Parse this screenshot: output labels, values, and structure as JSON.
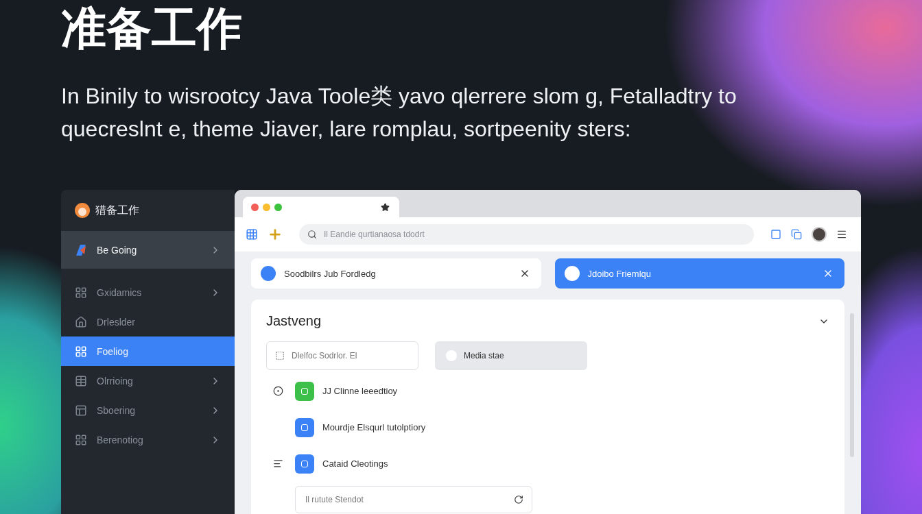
{
  "heading": {
    "title": "准备工作",
    "text": "In Binily to wisrootcy Java Toole类 yavo qlerrere slom g, Fetalladtry to quecreslnt e, theme Jiaver, lare romplau, sortpeenity sters:"
  },
  "sidebar": {
    "title": "猎备工作",
    "items": [
      {
        "label": "Be Going",
        "kind": "logo",
        "selected": false,
        "highlighted": true,
        "chevron": true
      },
      {
        "label": "Gxidamics",
        "kind": "grid",
        "selected": false,
        "highlighted": false,
        "chevron": true
      },
      {
        "label": "Drleslder",
        "kind": "home",
        "selected": false,
        "highlighted": false,
        "chevron": false
      },
      {
        "label": "Foeliog",
        "kind": "grid",
        "selected": true,
        "highlighted": false,
        "chevron": false
      },
      {
        "label": "Olrrioing",
        "kind": "table",
        "selected": false,
        "highlighted": false,
        "chevron": true
      },
      {
        "label": "Sboering",
        "kind": "layout",
        "selected": false,
        "highlighted": false,
        "chevron": true
      },
      {
        "label": "Berenotiog",
        "kind": "grid",
        "selected": false,
        "highlighted": false,
        "chevron": true
      }
    ]
  },
  "browser": {
    "address": {
      "placeholder": "Il Eandie qurtianaosa tdodrt"
    },
    "cards": [
      {
        "label": "Soodbilrs Jub Fordledg",
        "selected": false
      },
      {
        "label": "Jdoibo Friemlqu",
        "selected": true
      }
    ],
    "panel": {
      "title": "Jastveng",
      "field": {
        "placeholder": "Dlelfoc Sodrlor. El"
      },
      "button": "Media stae",
      "items": [
        {
          "label": "JJ Clinne leeedtioy",
          "color": "#3cc04a",
          "kind": "circle"
        },
        {
          "label": "Mourdje Elsqurl tutolptiory",
          "color": "#3b82f6",
          "kind": "plain"
        },
        {
          "label": "Cataid Cleotings",
          "color": "#3b82f6",
          "kind": "list"
        }
      ],
      "search": {
        "placeholder": "Il rutute Stendot"
      }
    }
  }
}
